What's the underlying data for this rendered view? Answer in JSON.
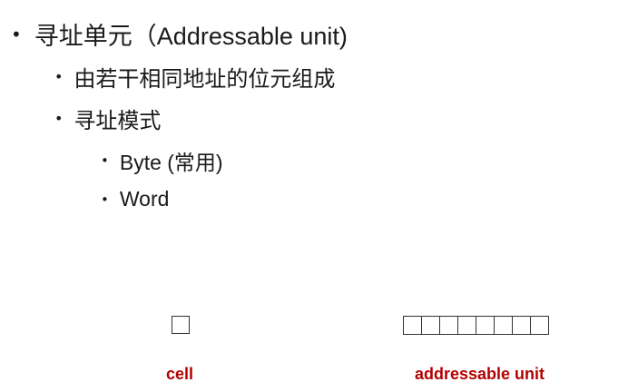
{
  "bullets": {
    "level1": "寻址单元（Addressable unit)",
    "level2_a": "由若干相同地址的位元组成",
    "level2_b": "寻址模式",
    "level3_a": "Byte (常用)",
    "level3_b": "Word"
  },
  "bullet_glyph": "•",
  "diagram": {
    "cell_label": "cell",
    "unit_label": "addressable unit",
    "unit_cell_count": 8,
    "label_color": "#b30000"
  }
}
